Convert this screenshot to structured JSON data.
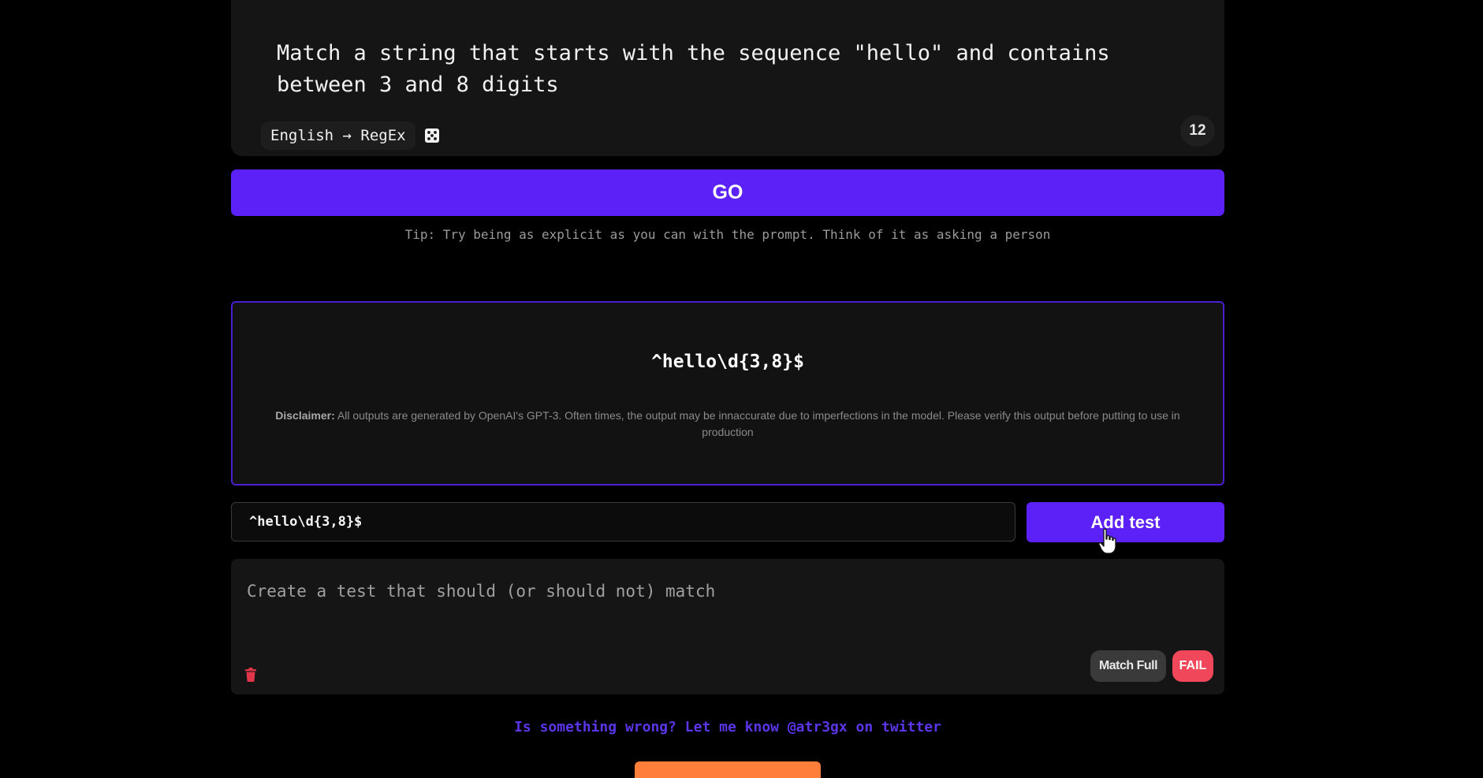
{
  "prompt": {
    "text": "Match a string that starts with the sequence \"hello\" and contains between 3 and 8 digits",
    "mode_label": "English → RegEx",
    "dice_icon": "dice-icon",
    "count": "12"
  },
  "go_button": {
    "label": "GO"
  },
  "tip": "Tip: Try being as explicit as you can with the prompt. Think of it as asking a person",
  "result": {
    "regex": "^hello\\d{3,8}$",
    "disclaimer_label": "Disclaimer:",
    "disclaimer_text": "All outputs are generated by OpenAI's GPT-3. Often times, the output may be innaccurate due to imperfections in the model. Please verify this output before putting to use in production"
  },
  "tester": {
    "regex_value": "^hello\\d{3,8}$",
    "add_test_label": "Add test"
  },
  "test_case": {
    "placeholder": "Create a test that should (or should not) match",
    "match_mode_label": "Match Full",
    "status_label": "FAIL"
  },
  "footer": {
    "feedback_text": "Is something wrong? Let me know @atr3gx on twitter"
  },
  "colors": {
    "accent": "#5b21f7",
    "fail": "#f0485a",
    "coffee": "#ff7f3a",
    "background": "#000000",
    "card": "#151515"
  }
}
